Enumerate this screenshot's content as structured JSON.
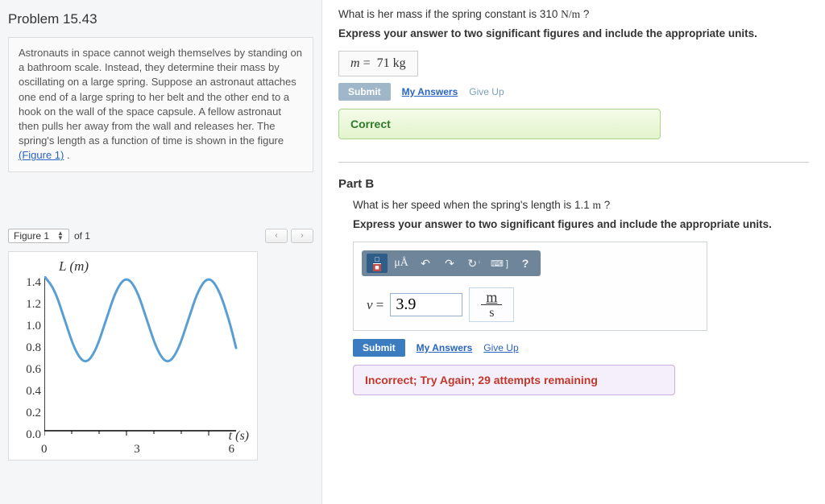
{
  "left": {
    "title": "Problem 15.43",
    "problem_text": "Astronauts in space cannot weigh themselves by standing on a bathroom scale. Instead, they determine their mass by oscillating on a large spring. Suppose an astronaut attaches one end of a large spring to her belt and the other end to a hook on the wall of the space capsule. A fellow astronaut then pulls her away from the wall and releases her. The spring's length as a function of time is shown in the figure ",
    "figure_link": "(Figure 1)",
    "problem_text_end": " .",
    "figure_control": {
      "label": "Figure 1",
      "of_label": "of 1",
      "prev": "‹",
      "next": "›"
    }
  },
  "chart_data": {
    "type": "line",
    "title": "",
    "y_title": "L (m)",
    "x_title": "t (s)",
    "xlim": [
      0,
      7
    ],
    "ylim": [
      0.0,
      1.4
    ],
    "x_ticks": [
      0,
      3,
      6
    ],
    "y_ticks": [
      0.0,
      0.2,
      0.4,
      0.6,
      0.8,
      1.0,
      1.2,
      1.4
    ],
    "series": [
      {
        "name": "L(t)",
        "x": [
          0.0,
          0.375,
          0.75,
          1.125,
          1.5,
          1.875,
          2.25,
          2.625,
          3.0,
          3.375,
          3.75,
          4.125,
          4.5,
          4.875,
          5.25,
          5.625,
          6.0,
          6.375,
          6.75,
          7.0
        ],
        "values": [
          1.4,
          1.28,
          1.0,
          0.72,
          0.6,
          0.72,
          1.0,
          1.28,
          1.4,
          1.28,
          1.0,
          0.72,
          0.6,
          0.72,
          1.0,
          1.28,
          1.4,
          1.28,
          1.0,
          0.75
        ]
      }
    ]
  },
  "partA": {
    "question": "What is her mass if the spring constant is 310 N/m ?",
    "instruction": "Express your answer to two significant figures and include the appropriate units.",
    "var": "m =",
    "value": "71 kg",
    "submit": "Submit",
    "my_answers": "My Answers",
    "give_up": "Give Up",
    "feedback": "Correct"
  },
  "partB": {
    "label": "Part B",
    "question": "What is her speed when the spring's length is 1.1 m ?",
    "instruction": "Express your answer to two significant figures and include the appropriate units.",
    "toolbar": {
      "unit_btn": "μÅ",
      "undo": "↶",
      "redo": "↷",
      "reset": "↻",
      "keyboard": "⌨ ]",
      "help": "?"
    },
    "var": "v =",
    "value": "3.9",
    "unit_num": "m",
    "unit_den": "s",
    "submit": "Submit",
    "my_answers": "My Answers",
    "give_up": "Give Up",
    "feedback": "Incorrect; Try Again; 29 attempts remaining"
  }
}
